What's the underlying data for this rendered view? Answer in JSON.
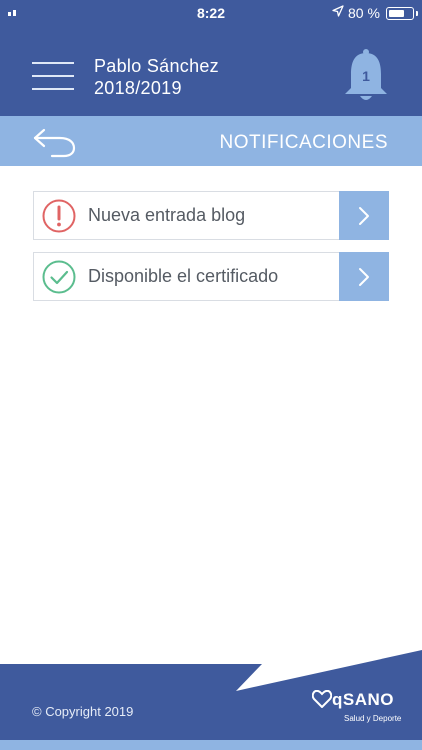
{
  "status_bar": {
    "time": "8:22",
    "battery_text": "80 %",
    "battery_level": 0.8,
    "location_icon": "location-arrow-icon"
  },
  "header": {
    "user_name": "Pablo Sánchez",
    "season": "2018/2019",
    "notification_count": "1",
    "menu_icon": "hamburger-menu-icon",
    "bell_icon": "bell-icon"
  },
  "subheader": {
    "title": "NOTIFICACIONES",
    "back_icon": "back-arrow-icon"
  },
  "notifications": [
    {
      "label": "Nueva entrada blog",
      "icon": "exclamation-circle-icon",
      "icon_color": "#e06464"
    },
    {
      "label": "Disponible el certificado",
      "icon": "checkmark-circle-icon",
      "icon_color": "#5bbd8e"
    }
  ],
  "footer": {
    "copyright": "© Copyright 2019",
    "logo_text": "qSANO",
    "logo_tagline": "Salud y Deporte"
  },
  "colors": {
    "primary": "#3f5a9d",
    "secondary": "#8fb4e2",
    "text": "#555b63"
  }
}
